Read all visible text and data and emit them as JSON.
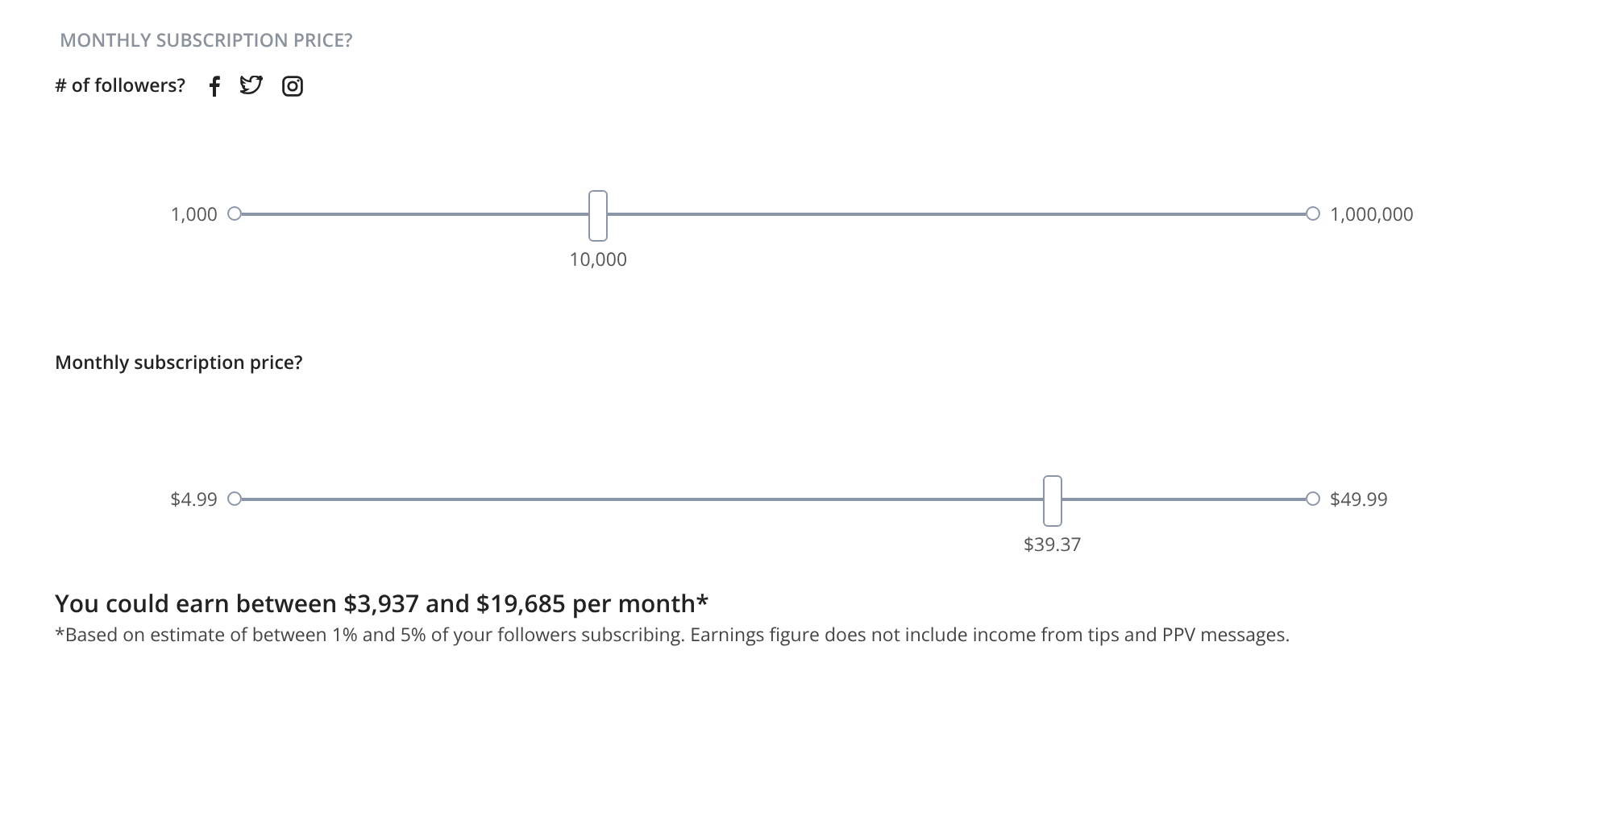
{
  "heading": "MONTHLY SUBSCRIPTION PRICE?",
  "sliders": [
    {
      "label": "# of followers?",
      "show_social": true,
      "min": "1,000",
      "max": "1,000,000",
      "value": "10,000",
      "level": 0.335
    },
    {
      "label": "Monthly subscription price?",
      "show_social": false,
      "min": "$4.99",
      "max": "$49.99",
      "value": "$39.37",
      "level": 0.762
    }
  ],
  "result": {
    "title": "You could earn between $3,937 and $19,685 per month*",
    "note": "*Based on estimate of between 1% and 5% of your followers subscribing. Earnings figure does not include income from tips and PPV messages."
  }
}
